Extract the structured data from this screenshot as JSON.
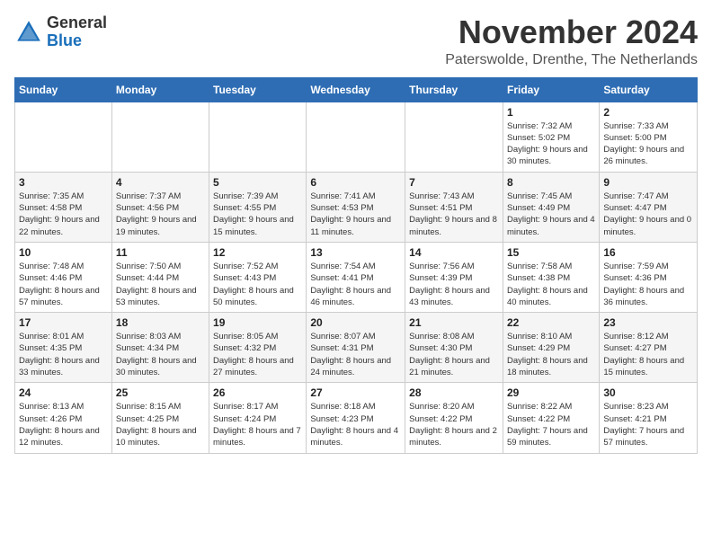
{
  "logo": {
    "general": "General",
    "blue": "Blue"
  },
  "header": {
    "month": "November 2024",
    "location": "Paterswolde, Drenthe, The Netherlands"
  },
  "weekdays": [
    "Sunday",
    "Monday",
    "Tuesday",
    "Wednesday",
    "Thursday",
    "Friday",
    "Saturday"
  ],
  "weeks": [
    [
      {
        "day": "",
        "detail": ""
      },
      {
        "day": "",
        "detail": ""
      },
      {
        "day": "",
        "detail": ""
      },
      {
        "day": "",
        "detail": ""
      },
      {
        "day": "",
        "detail": ""
      },
      {
        "day": "1",
        "detail": "Sunrise: 7:32 AM\nSunset: 5:02 PM\nDaylight: 9 hours and 30 minutes."
      },
      {
        "day": "2",
        "detail": "Sunrise: 7:33 AM\nSunset: 5:00 PM\nDaylight: 9 hours and 26 minutes."
      }
    ],
    [
      {
        "day": "3",
        "detail": "Sunrise: 7:35 AM\nSunset: 4:58 PM\nDaylight: 9 hours and 22 minutes."
      },
      {
        "day": "4",
        "detail": "Sunrise: 7:37 AM\nSunset: 4:56 PM\nDaylight: 9 hours and 19 minutes."
      },
      {
        "day": "5",
        "detail": "Sunrise: 7:39 AM\nSunset: 4:55 PM\nDaylight: 9 hours and 15 minutes."
      },
      {
        "day": "6",
        "detail": "Sunrise: 7:41 AM\nSunset: 4:53 PM\nDaylight: 9 hours and 11 minutes."
      },
      {
        "day": "7",
        "detail": "Sunrise: 7:43 AM\nSunset: 4:51 PM\nDaylight: 9 hours and 8 minutes."
      },
      {
        "day": "8",
        "detail": "Sunrise: 7:45 AM\nSunset: 4:49 PM\nDaylight: 9 hours and 4 minutes."
      },
      {
        "day": "9",
        "detail": "Sunrise: 7:47 AM\nSunset: 4:47 PM\nDaylight: 9 hours and 0 minutes."
      }
    ],
    [
      {
        "day": "10",
        "detail": "Sunrise: 7:48 AM\nSunset: 4:46 PM\nDaylight: 8 hours and 57 minutes."
      },
      {
        "day": "11",
        "detail": "Sunrise: 7:50 AM\nSunset: 4:44 PM\nDaylight: 8 hours and 53 minutes."
      },
      {
        "day": "12",
        "detail": "Sunrise: 7:52 AM\nSunset: 4:43 PM\nDaylight: 8 hours and 50 minutes."
      },
      {
        "day": "13",
        "detail": "Sunrise: 7:54 AM\nSunset: 4:41 PM\nDaylight: 8 hours and 46 minutes."
      },
      {
        "day": "14",
        "detail": "Sunrise: 7:56 AM\nSunset: 4:39 PM\nDaylight: 8 hours and 43 minutes."
      },
      {
        "day": "15",
        "detail": "Sunrise: 7:58 AM\nSunset: 4:38 PM\nDaylight: 8 hours and 40 minutes."
      },
      {
        "day": "16",
        "detail": "Sunrise: 7:59 AM\nSunset: 4:36 PM\nDaylight: 8 hours and 36 minutes."
      }
    ],
    [
      {
        "day": "17",
        "detail": "Sunrise: 8:01 AM\nSunset: 4:35 PM\nDaylight: 8 hours and 33 minutes."
      },
      {
        "day": "18",
        "detail": "Sunrise: 8:03 AM\nSunset: 4:34 PM\nDaylight: 8 hours and 30 minutes."
      },
      {
        "day": "19",
        "detail": "Sunrise: 8:05 AM\nSunset: 4:32 PM\nDaylight: 8 hours and 27 minutes."
      },
      {
        "day": "20",
        "detail": "Sunrise: 8:07 AM\nSunset: 4:31 PM\nDaylight: 8 hours and 24 minutes."
      },
      {
        "day": "21",
        "detail": "Sunrise: 8:08 AM\nSunset: 4:30 PM\nDaylight: 8 hours and 21 minutes."
      },
      {
        "day": "22",
        "detail": "Sunrise: 8:10 AM\nSunset: 4:29 PM\nDaylight: 8 hours and 18 minutes."
      },
      {
        "day": "23",
        "detail": "Sunrise: 8:12 AM\nSunset: 4:27 PM\nDaylight: 8 hours and 15 minutes."
      }
    ],
    [
      {
        "day": "24",
        "detail": "Sunrise: 8:13 AM\nSunset: 4:26 PM\nDaylight: 8 hours and 12 minutes."
      },
      {
        "day": "25",
        "detail": "Sunrise: 8:15 AM\nSunset: 4:25 PM\nDaylight: 8 hours and 10 minutes."
      },
      {
        "day": "26",
        "detail": "Sunrise: 8:17 AM\nSunset: 4:24 PM\nDaylight: 8 hours and 7 minutes."
      },
      {
        "day": "27",
        "detail": "Sunrise: 8:18 AM\nSunset: 4:23 PM\nDaylight: 8 hours and 4 minutes."
      },
      {
        "day": "28",
        "detail": "Sunrise: 8:20 AM\nSunset: 4:22 PM\nDaylight: 8 hours and 2 minutes."
      },
      {
        "day": "29",
        "detail": "Sunrise: 8:22 AM\nSunset: 4:22 PM\nDaylight: 7 hours and 59 minutes."
      },
      {
        "day": "30",
        "detail": "Sunrise: 8:23 AM\nSunset: 4:21 PM\nDaylight: 7 hours and 57 minutes."
      }
    ]
  ]
}
